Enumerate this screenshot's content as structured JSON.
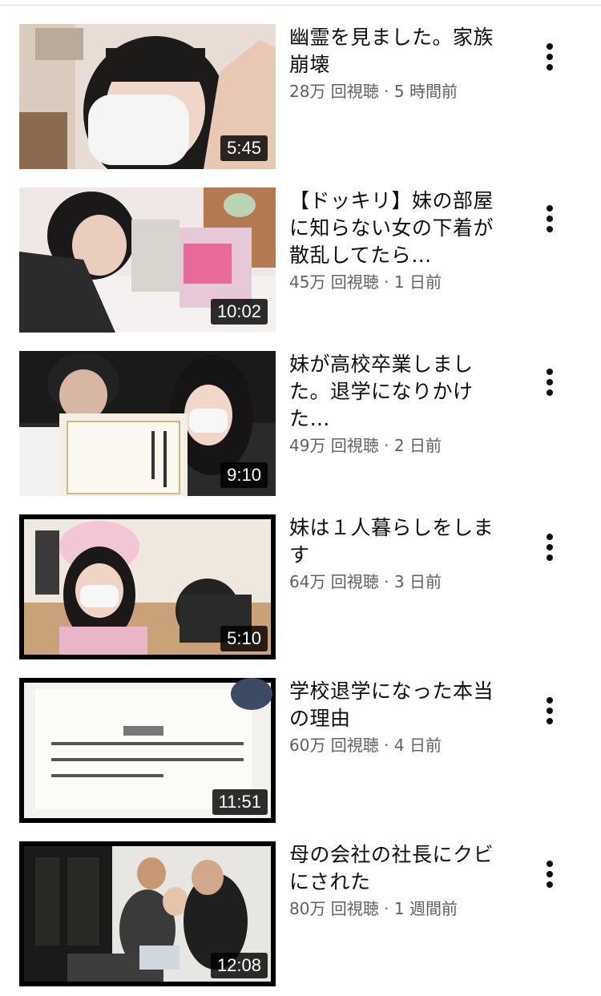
{
  "videos": [
    {
      "title": "幽霊を見ました。家族崩壊",
      "views": "28万 回視聴",
      "separator": "·",
      "age": "5 時間前",
      "duration": "5:45",
      "more_icon": "more-vert-icon"
    },
    {
      "title": "【ドッキリ】妹の部屋に知らない女の下着が散乱してたら…",
      "views": "45万 回視聴",
      "separator": "·",
      "age": "1 日前",
      "duration": "10:02",
      "more_icon": "more-vert-icon"
    },
    {
      "title": "妹が高校卒業しました。退学になりかけた…",
      "views": "49万 回視聴",
      "separator": "·",
      "age": "2 日前",
      "duration": "9:10",
      "more_icon": "more-vert-icon"
    },
    {
      "title": "妹は１人暮らしをします",
      "views": "64万 回視聴",
      "separator": "·",
      "age": "3 日前",
      "duration": "5:10",
      "more_icon": "more-vert-icon"
    },
    {
      "title": "学校退学になった本当の理由",
      "views": "60万 回視聴",
      "separator": "·",
      "age": "4 日前",
      "duration": "11:51",
      "more_icon": "more-vert-icon"
    },
    {
      "title": "母の会社の社長にクビにされた",
      "views": "80万 回視聴",
      "separator": "·",
      "age": "1 週間前",
      "duration": "12:08",
      "more_icon": "more-vert-icon"
    }
  ]
}
